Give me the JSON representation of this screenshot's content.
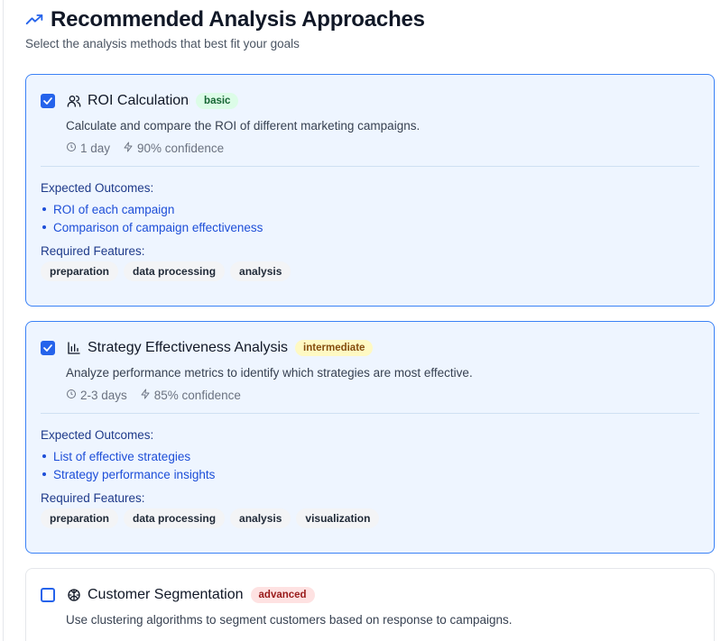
{
  "header": {
    "icon": "trending-up-icon",
    "title": "Recommended Analysis Approaches",
    "subtitle": "Select the analysis methods that best fit your goals"
  },
  "colors": {
    "accent": "#2563eb",
    "selected_bg": "#eef5ff",
    "basic": "#dcfce7",
    "intermediate": "#fef9c3",
    "advanced": "#fee2e2"
  },
  "labels": {
    "expected_outcomes": "Expected Outcomes:",
    "required_features": "Required Features:"
  },
  "methods": [
    {
      "selected": true,
      "icon": "users-icon",
      "title": "ROI Calculation",
      "level": "basic",
      "description": "Calculate and compare the ROI of different marketing campaigns.",
      "duration": "1 day",
      "confidence": "90% confidence",
      "outcomes": [
        "ROI of each campaign",
        "Comparison of campaign effectiveness"
      ],
      "features": [
        "preparation",
        "data processing",
        "analysis"
      ]
    },
    {
      "selected": true,
      "icon": "bar-chart-icon",
      "title": "Strategy Effectiveness Analysis",
      "level": "intermediate",
      "description": "Analyze performance metrics to identify which strategies are most effective.",
      "duration": "2-3 days",
      "confidence": "85% confidence",
      "outcomes": [
        "List of effective strategies",
        "Strategy performance insights"
      ],
      "features": [
        "preparation",
        "data processing",
        "analysis",
        "visualization"
      ]
    },
    {
      "selected": false,
      "icon": "brain-icon",
      "title": "Customer Segmentation",
      "level": "advanced",
      "description": "Use clustering algorithms to segment customers based on response to campaigns."
    }
  ]
}
